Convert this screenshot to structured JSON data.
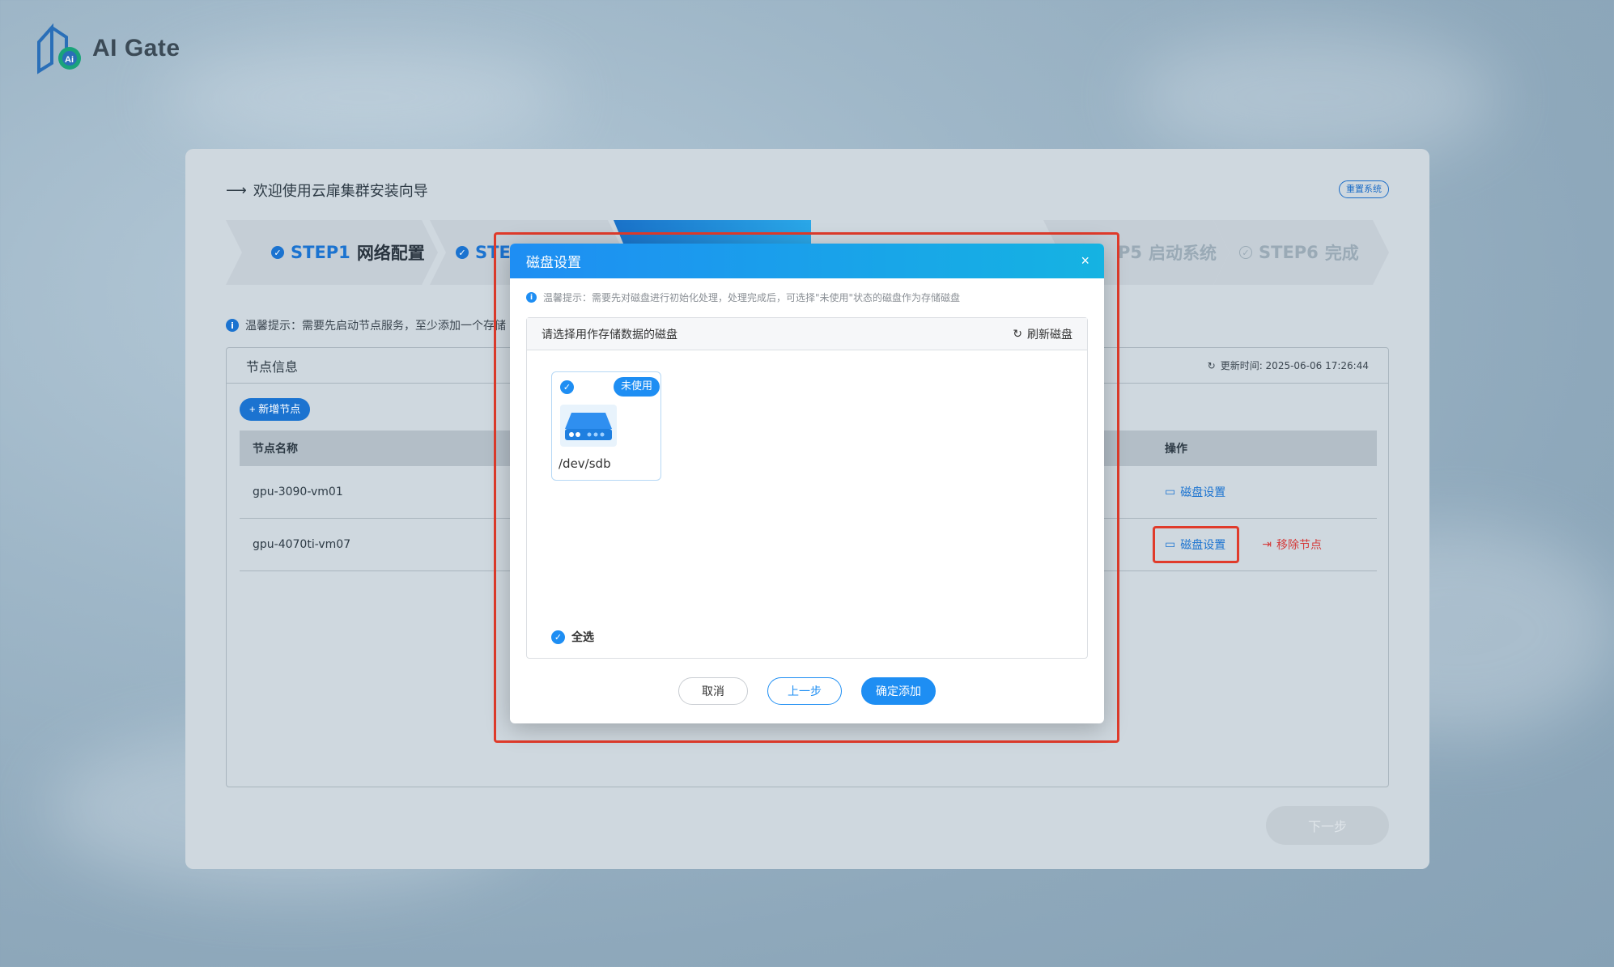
{
  "brand": {
    "name": "AI Gate",
    "accent": "#1b73d0"
  },
  "wizard": {
    "title": "欢迎使用云扉集群安装向导",
    "reset_label": "重置系统",
    "next_label": "下一步",
    "steps": [
      {
        "num": "STEP1",
        "label": "网络配置",
        "state": "done"
      },
      {
        "num": "STE",
        "label": "",
        "state": "done"
      },
      {
        "num": "P5",
        "label": "启动系统",
        "state": "muted"
      },
      {
        "num": "STEP6",
        "label": "完成",
        "state": "muted"
      }
    ],
    "tip": "温馨提示：需要先启动节点服务，至少添加一个存储"
  },
  "nodes": {
    "panel_title": "节点信息",
    "update_time": "更新时间: 2025-06-06 17:26:44",
    "add_label": "+ 新增节点",
    "columns": {
      "name": "节点名称",
      "ops": "操作"
    },
    "rows": [
      {
        "name": "gpu-3090-vm01",
        "disk_label": "磁盘设置"
      },
      {
        "name": "gpu-4070ti-vm07",
        "disk_label": "磁盘设置",
        "remove_label": "移除节点"
      }
    ]
  },
  "modal": {
    "title": "磁盘设置",
    "close": "×",
    "tip": "温馨提示：需要先对磁盘进行初始化处理，处理完成后，可选择\"未使用\"状态的磁盘作为存储磁盘",
    "panel_title": "请选择用作存储数据的磁盘",
    "refresh_label": "刷新磁盘",
    "disks": [
      {
        "name": "/dev/sdb",
        "status": "未使用",
        "checked": true
      }
    ],
    "select_all_label": "全选",
    "buttons": {
      "cancel": "取消",
      "prev": "上一步",
      "confirm": "确定添加"
    }
  }
}
